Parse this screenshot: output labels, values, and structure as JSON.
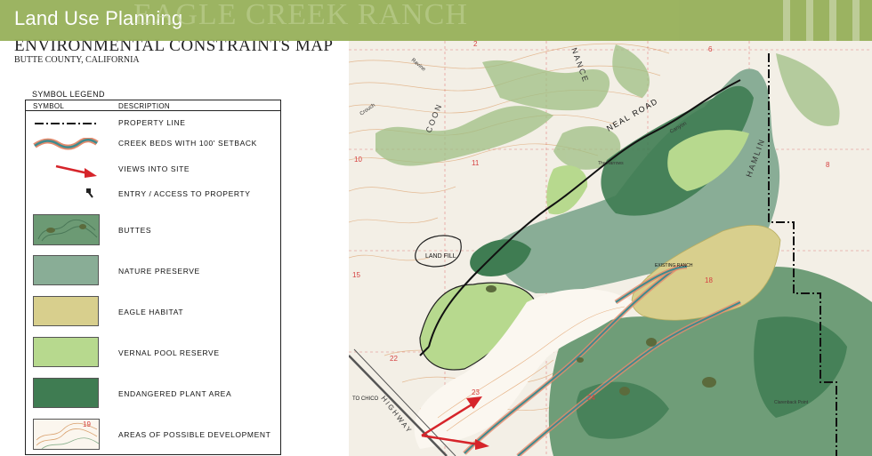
{
  "banner": {
    "title": "Land Use Planning",
    "faded_title": "EAGLE CREEK RANCH"
  },
  "map_header": {
    "title": "ENVIRONMENTAL CONSTRAINTS MAP",
    "subtitle": "BUTTE COUNTY, CALIFORNIA"
  },
  "legend": {
    "heading": "SYMBOL LEGEND",
    "col_symbol": "SYMBOL",
    "col_description": "DESCRIPTION",
    "items": [
      {
        "label": "Property Line"
      },
      {
        "label": "Creek beds with 100' setback"
      },
      {
        "label": "Views into site"
      },
      {
        "label": "Entry / access to property"
      },
      {
        "label": "Buttes"
      },
      {
        "label": "Nature Preserve"
      },
      {
        "label": "Eagle Habitat"
      },
      {
        "label": "Vernal Pool Reserve"
      },
      {
        "label": "Endangered Plant Area"
      },
      {
        "label": "Areas of possible development"
      }
    ]
  },
  "map_labels": {
    "road": "NEAL ROAD",
    "coon": "COON",
    "nance": "NANCE",
    "hamlin": "HAMLIN",
    "highway": "HIGHWAY",
    "land_fill": "LAND FILL",
    "existing_ranch": "EXISTING RANCH",
    "to_chico": "TO CHICO",
    "nugen_canyon": "Canyon",
    "narrows": "The Narrows",
    "crouch": "Crouch",
    "ravine": "Ravine",
    "clarenback": "Clarenback Point",
    "sec_2": "2",
    "sec_6": "6",
    "sec_10": "10",
    "sec_11": "11",
    "sec_8": "8",
    "sec_15": "15",
    "sec_18": "18",
    "sec_22": "22",
    "sec_23": "23",
    "sec_24": "24",
    "sec_19": "19"
  },
  "colors": {
    "banner": "#97b05a",
    "butte": "#6c9a74",
    "nature_preserve": "#89ad96",
    "eagle_habitat": "#d8cf8d",
    "vernal_pool": "#b7d98e",
    "endangered_plant": "#3f7c52",
    "view_arrow": "#d6242a",
    "creek": "#3e8a8e"
  }
}
